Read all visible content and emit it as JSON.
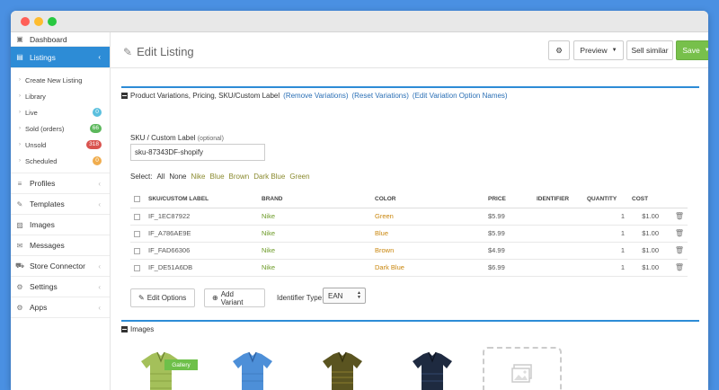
{
  "sidebar": {
    "dashboard": "Dashboard",
    "listings": "Listings",
    "sub_items": [
      {
        "label": "Create New Listing",
        "badge": null
      },
      {
        "label": "Library",
        "badge": null
      },
      {
        "label": "Live",
        "badge": "0",
        "badge_color": "#5bc0de"
      },
      {
        "label": "Sold (orders)",
        "badge": "66",
        "badge_color": "#5cb85c"
      },
      {
        "label": "Unsold",
        "badge": "318",
        "badge_color": "#d9534f"
      },
      {
        "label": "Scheduled",
        "badge": "0",
        "badge_color": "#f0ad4e"
      }
    ],
    "sections": [
      "Profiles",
      "Templates",
      "Images",
      "Messages",
      "Store Connector",
      "Settings",
      "Apps"
    ]
  },
  "header": {
    "title": "Edit Listing",
    "preview_label": "Preview",
    "sell_similar_label": "Sell similar",
    "save_label": "Save"
  },
  "variations": {
    "title": "Product Variations, Pricing, SKU/Custom Label",
    "remove_link": "(Remove Variations)",
    "reset_link": "(Reset Variations)",
    "edit_names_link": "(Edit Variation Option Names)",
    "sku_label": "SKU / Custom Label",
    "sku_optional": "(optional)",
    "sku_value": "sku-87343DF-shopify",
    "select_label": "Select:",
    "select_options": [
      "All",
      "None",
      "Nike",
      "Blue",
      "Brown",
      "Dark Blue",
      "Green"
    ],
    "columns": [
      "SKU/CUSTOM LABEL",
      "BRAND",
      "COLOR",
      "PRICE",
      "IDENTIFIER",
      "QUANTITY",
      "COST"
    ],
    "rows": [
      {
        "sku": "IF_1EC87922",
        "brand": "Nike",
        "color": "Green",
        "price": "$5.99",
        "identifier": "",
        "quantity": "1",
        "cost": "$1.00"
      },
      {
        "sku": "IF_A786AE9E",
        "brand": "Nike",
        "color": "Blue",
        "price": "$5.99",
        "identifier": "",
        "quantity": "1",
        "cost": "$1.00"
      },
      {
        "sku": "IF_FAD66306",
        "brand": "Nike",
        "color": "Brown",
        "price": "$4.99",
        "identifier": "",
        "quantity": "1",
        "cost": "$1.00"
      },
      {
        "sku": "IF_DE51A6DB",
        "brand": "Nike",
        "color": "Dark Blue",
        "price": "$6.99",
        "identifier": "",
        "quantity": "1",
        "cost": "$1.00"
      }
    ],
    "edit_options_label": "Edit Options",
    "add_variant_label": "Add Variant",
    "identifier_type_label": "Identifier Type:",
    "identifier_type_value": "EAN"
  },
  "images": {
    "title": "Images",
    "gallery_tag": "Gallery",
    "shirt_colors": [
      "#a4c05a",
      "#4d8fd8",
      "#5a5420",
      "#1e2a40"
    ]
  },
  "colors": {
    "accent": "#2d8cd6",
    "save": "#77c04b"
  }
}
